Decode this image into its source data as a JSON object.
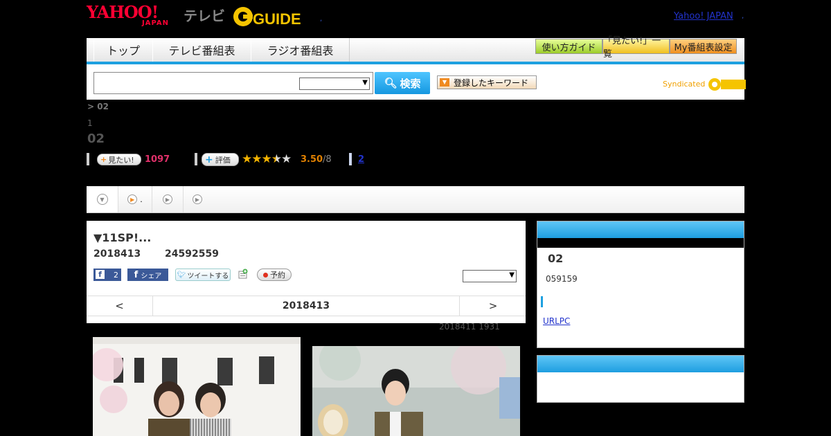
{
  "header": {
    "logo_yahoo": "YAHOO!",
    "logo_japan": "JAPAN",
    "logo_tv": "テレビ",
    "logo_gguide": "GUIDE",
    "yahoo_japan_link": "Yahoo! JAPAN",
    "dot1": ",",
    "dot2": ","
  },
  "nav": {
    "tabs": [
      "トップ",
      "テレビ番組表",
      "ラジオ番組表"
    ],
    "guide_buttons": [
      "使い方ガイド",
      "「見たい!」一覧",
      "My番組表設定"
    ]
  },
  "search": {
    "input_value": "",
    "select_value": "",
    "button_label": "検索",
    "keyword_button_label": "登録したキーワード",
    "syndicated_label": "Syndicated"
  },
  "breadcrumb": "> 02",
  "sub_number": "1",
  "title": "02",
  "stats": {
    "want_label": "見たい!",
    "want_count": "1097",
    "rate_label": "評価",
    "stars": "★★★★★",
    "rating": "3.50",
    "rating_sub": "/8",
    "reviews_link": "2"
  },
  "playbar": {
    "item2_suffix": "."
  },
  "program": {
    "title": "▼11SP!...",
    "date": "2018413",
    "ratio": "24592559",
    "fb_like_count": "2",
    "fb_share_label": "シェア",
    "tweet_label": "ツイートする",
    "reserve_label": "予約",
    "select_value": ""
  },
  "date_nav": {
    "prev": "<",
    "current": "2018413",
    "next": ">"
  },
  "updated": "2018411  1931",
  "sidebar": {
    "box1_title": "02",
    "box1_sub": "059159",
    "box1_link": "URLPC"
  },
  "colors": {
    "accent_blue": "#1ea0e0",
    "brand_red": "#ff0033",
    "want_pink": "#e0306a",
    "rating_orange": "#e08000"
  }
}
